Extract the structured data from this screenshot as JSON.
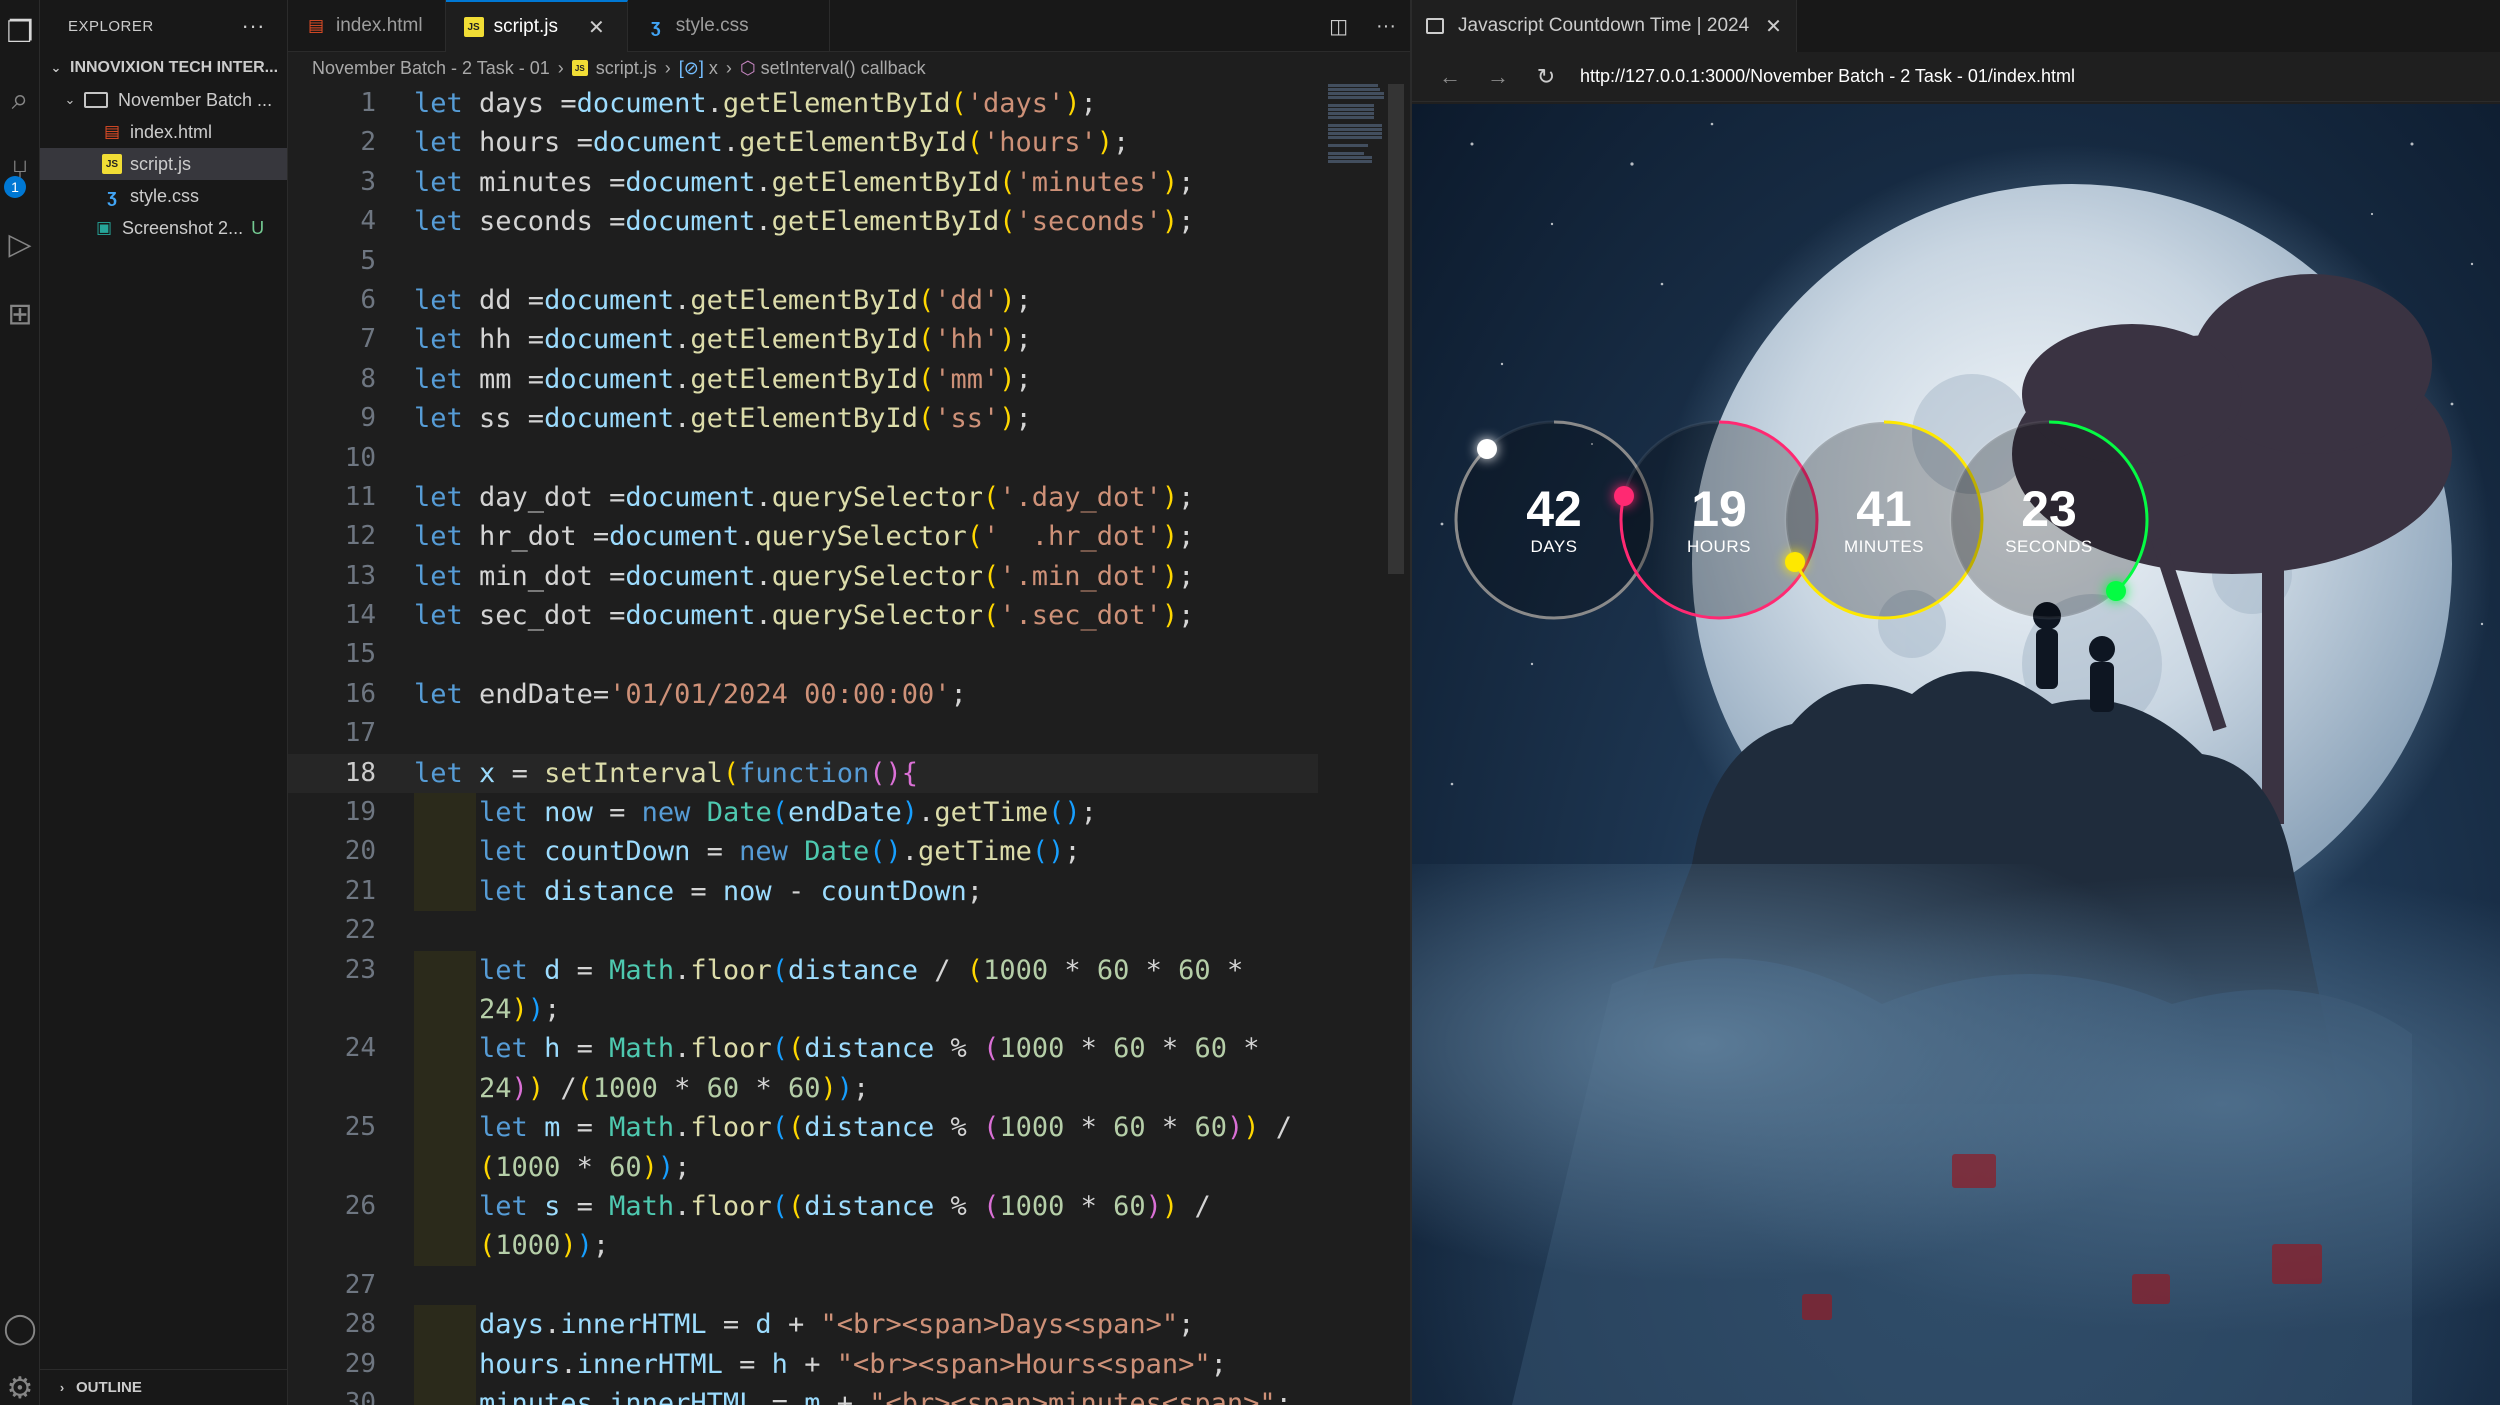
{
  "explorer": {
    "title": "EXPLORER",
    "root": "INNOVIXION TECH INTER...",
    "folder": "November Batch ...",
    "files": [
      {
        "name": "index.html",
        "type": "html"
      },
      {
        "name": "script.js",
        "type": "js"
      },
      {
        "name": "style.css",
        "type": "css"
      },
      {
        "name": "Screenshot 2...",
        "type": "img",
        "git": "U"
      }
    ],
    "outline": "OUTLINE",
    "badge": "1"
  },
  "editor": {
    "tabs": [
      {
        "label": "index.html",
        "type": "html"
      },
      {
        "label": "script.js",
        "type": "js"
      },
      {
        "label": "style.css",
        "type": "css"
      }
    ],
    "breadcrumb": {
      "folder": "November Batch - 2 Task - 01",
      "file": "script.js",
      "symbol": "x",
      "callback": "setInterval() callback"
    },
    "current_line": 18,
    "lines": [
      {
        "n": "1",
        "h": "<span class='kwb'>let</span> days =<span class='var'>document</span>.<span class='fn'>getElementById</span><span class='par1'>(</span><span class='str'>'days'</span><span class='par1'>)</span>;"
      },
      {
        "n": "2",
        "h": "<span class='kwb'>let</span> hours =<span class='var'>document</span>.<span class='fn'>getElementById</span><span class='par1'>(</span><span class='str'>'hours'</span><span class='par1'>)</span>;"
      },
      {
        "n": "3",
        "h": "<span class='kwb'>let</span> minutes =<span class='var'>document</span>.<span class='fn'>getElementById</span><span class='par1'>(</span><span class='str'>'minutes'</span><span class='par1'>)</span>;"
      },
      {
        "n": "4",
        "h": "<span class='kwb'>let</span> seconds =<span class='var'>document</span>.<span class='fn'>getElementById</span><span class='par1'>(</span><span class='str'>'seconds'</span><span class='par1'>)</span>;"
      },
      {
        "n": "5",
        "h": ""
      },
      {
        "n": "6",
        "h": "<span class='kwb'>let</span> dd =<span class='var'>document</span>.<span class='fn'>getElementById</span><span class='par1'>(</span><span class='str'>'dd'</span><span class='par1'>)</span>;"
      },
      {
        "n": "7",
        "h": "<span class='kwb'>let</span> hh =<span class='var'>document</span>.<span class='fn'>getElementById</span><span class='par1'>(</span><span class='str'>'hh'</span><span class='par1'>)</span>;"
      },
      {
        "n": "8",
        "h": "<span class='kwb'>let</span> mm =<span class='var'>document</span>.<span class='fn'>getElementById</span><span class='par1'>(</span><span class='str'>'mm'</span><span class='par1'>)</span>;"
      },
      {
        "n": "9",
        "h": "<span class='kwb'>let</span> ss =<span class='var'>document</span>.<span class='fn'>getElementById</span><span class='par1'>(</span><span class='str'>'ss'</span><span class='par1'>)</span>;"
      },
      {
        "n": "10",
        "h": ""
      },
      {
        "n": "11",
        "h": "<span class='kwb'>let</span> day_dot =<span class='var'>document</span>.<span class='fn'>querySelector</span><span class='par1'>(</span><span class='str'>'.day_dot'</span><span class='par1'>)</span>;"
      },
      {
        "n": "12",
        "h": "<span class='kwb'>let</span> hr_dot =<span class='var'>document</span>.<span class='fn'>querySelector</span><span class='par1'>(</span><span class='str'>'  .hr_dot'</span><span class='par1'>)</span>;"
      },
      {
        "n": "13",
        "h": "<span class='kwb'>let</span> min_dot =<span class='var'>document</span>.<span class='fn'>querySelector</span><span class='par1'>(</span><span class='str'>'.min_dot'</span><span class='par1'>)</span>;"
      },
      {
        "n": "14",
        "h": "<span class='kwb'>let</span> sec_dot =<span class='var'>document</span>.<span class='fn'>querySelector</span><span class='par1'>(</span><span class='str'>'.sec_dot'</span><span class='par1'>)</span>;"
      },
      {
        "n": "15",
        "h": ""
      },
      {
        "n": "16",
        "h": "<span class='kwb'>let</span> endDate=<span class='str'>'01/01/2024 00:00:00'</span>;"
      },
      {
        "n": "17",
        "h": ""
      },
      {
        "n": "18",
        "h": "<span class='kwb'>let</span> <span class='var'>x</span> = <span class='fn'>setInterval</span><span class='par1'>(</span><span class='kwb'>function</span><span class='par2'>()</span><span class='par2'>{</span>"
      },
      {
        "n": "19",
        "h": "    <span class='kwb'>let</span> <span class='var'>now</span> = <span class='kwb'>new</span> <span class='cls'>Date</span><span class='par3'>(</span><span class='var'>endDate</span><span class='par3'>)</span>.<span class='fn'>getTime</span><span class='par3'>()</span>;"
      },
      {
        "n": "20",
        "h": "    <span class='kwb'>let</span> <span class='var'>countDown</span> = <span class='kwb'>new</span> <span class='cls'>Date</span><span class='par3'>()</span>.<span class='fn'>getTime</span><span class='par3'>()</span>;"
      },
      {
        "n": "21",
        "h": "    <span class='kwb'>let</span> <span class='var'>distance</span> = <span class='var'>now</span> - <span class='var'>countDown</span>;"
      },
      {
        "n": "22",
        "h": ""
      },
      {
        "n": "23",
        "h": "    <span class='kwb'>let</span> <span class='var'>d</span> = <span class='cls'>Math</span>.<span class='fn'>floor</span><span class='par3'>(</span><span class='var'>distance</span> / <span class='par1'>(</span><span class='num'>1000</span> * <span class='num'>60</span> * <span class='num'>60</span> *"
      },
      {
        "n": "",
        "h": "    <span class='num'>24</span><span class='par1'>)</span><span class='par3'>)</span>;"
      },
      {
        "n": "24",
        "h": "    <span class='kwb'>let</span> <span class='var'>h</span> = <span class='cls'>Math</span>.<span class='fn'>floor</span><span class='par3'>(</span><span class='par1'>(</span><span class='var'>distance</span> % <span class='par2'>(</span><span class='num'>1000</span> * <span class='num'>60</span> * <span class='num'>60</span> *"
      },
      {
        "n": "",
        "h": "    <span class='num'>24</span><span class='par2'>)</span><span class='par1'>)</span> /<span class='par1'>(</span><span class='num'>1000</span> * <span class='num'>60</span> * <span class='num'>60</span><span class='par1'>)</span><span class='par3'>)</span>;"
      },
      {
        "n": "25",
        "h": "    <span class='kwb'>let</span> <span class='var'>m</span> = <span class='cls'>Math</span>.<span class='fn'>floor</span><span class='par3'>(</span><span class='par1'>(</span><span class='var'>distance</span> % <span class='par2'>(</span><span class='num'>1000</span> * <span class='num'>60</span> * <span class='num'>60</span><span class='par2'>)</span><span class='par1'>)</span> /"
      },
      {
        "n": "",
        "h": "    <span class='par1'>(</span><span class='num'>1000</span> * <span class='num'>60</span><span class='par1'>)</span><span class='par3'>)</span>;"
      },
      {
        "n": "26",
        "h": "    <span class='kwb'>let</span> <span class='var'>s</span> = <span class='cls'>Math</span>.<span class='fn'>floor</span><span class='par3'>(</span><span class='par1'>(</span><span class='var'>distance</span> % <span class='par2'>(</span><span class='num'>1000</span> * <span class='num'>60</span><span class='par2'>)</span><span class='par1'>)</span> /"
      },
      {
        "n": "",
        "h": "    <span class='par1'>(</span><span class='num'>1000</span><span class='par1'>)</span><span class='par3'>)</span>;"
      },
      {
        "n": "27",
        "h": ""
      },
      {
        "n": "28",
        "h": "    <span class='var'>days</span>.<span class='var'>innerHTML</span> = <span class='var'>d</span> + <span class='str'>\"&lt;br&gt;&lt;span&gt;Days&lt;span&gt;\"</span>;"
      },
      {
        "n": "29",
        "h": "    <span class='var'>hours</span>.<span class='var'>innerHTML</span> = <span class='var'>h</span> + <span class='str'>\"&lt;br&gt;&lt;span&gt;Hours&lt;span&gt;\"</span>;"
      },
      {
        "n": "30",
        "h": "    <span class='var'>minutes</span>.<span class='var'>innerHTML</span> = <span class='var'>m</span> + <span class='str'>\"&lt;br&gt;&lt;span&gt;minutes&lt;span&gt;\"</span>;"
      }
    ]
  },
  "browser": {
    "tab_title": "Javascript Countdown Time | 2024",
    "url": "http://127.0.0.1:3000/November Batch - 2 Task - 01/index.html",
    "timers": [
      {
        "id": "days",
        "value": "42",
        "label": "DAYS",
        "color": "#8a8a8a",
        "dot": "#ffffff",
        "progress": 0.88
      },
      {
        "id": "hours",
        "value": "19",
        "label": "HOURS",
        "color": "#ff2972",
        "dot": "#ff2972",
        "progress": 0.79
      },
      {
        "id": "minutes",
        "value": "41",
        "label": "MINUTES",
        "color": "#fee800",
        "dot": "#fee800",
        "progress": 0.68
      },
      {
        "id": "seconds",
        "value": "23",
        "label": "SECONDS",
        "color": "#04fc43",
        "dot": "#04fc43",
        "progress": 0.38
      }
    ]
  }
}
